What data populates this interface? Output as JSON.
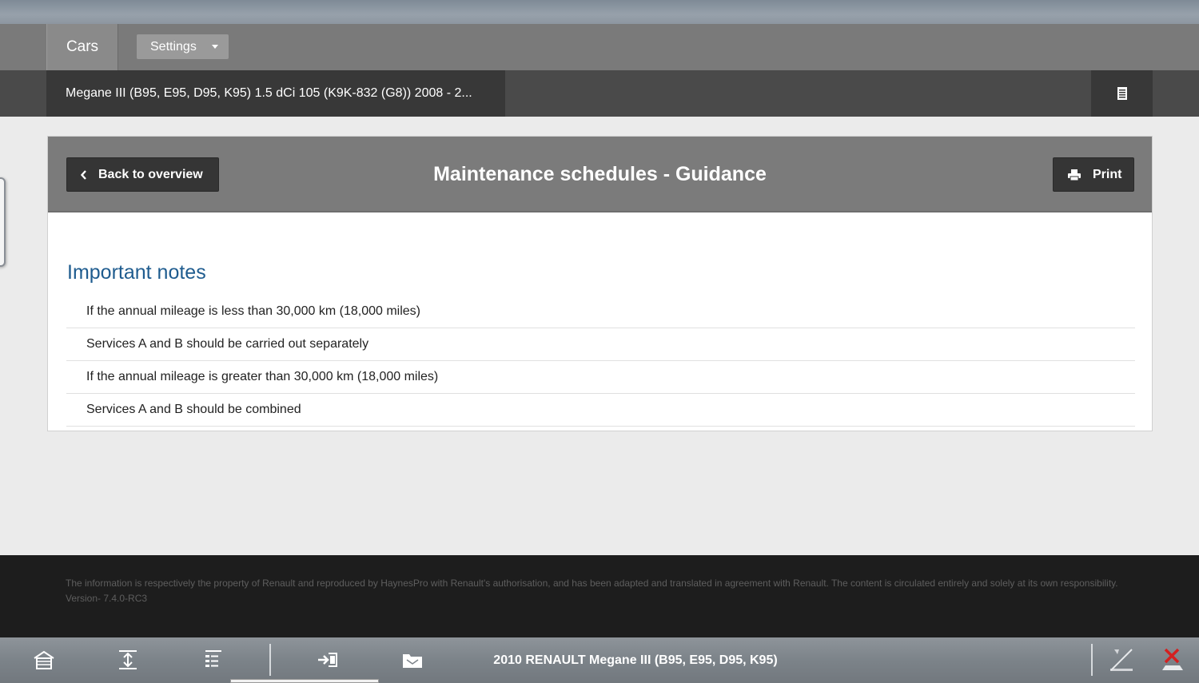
{
  "tabs": {
    "cars_label": "Cars",
    "settings_label": "Settings"
  },
  "vehicle": {
    "title": "Megane III (B95, E95, D95, K95) 1.5 dCi 105 (K9K-832 (G8)) 2008 - 2..."
  },
  "panel": {
    "back_label": "Back to overview",
    "title": "Maintenance schedules - Guidance",
    "print_label": "Print"
  },
  "notes": {
    "heading": "Important notes",
    "items": [
      "If the annual mileage is less than 30,000 km (18,000 miles)",
      "Services A and B should be carried out separately",
      "If the annual mileage is greater than 30,000 km (18,000 miles)",
      "Services A and B should be combined"
    ]
  },
  "footer": {
    "disclaimer": "The information is respectively the property of Renault and reproduced by HaynesPro with Renault's authorisation, and has been adapted and translated in agreement with Renault. The content is circulated entirely and solely at its own responsibility.",
    "version": "Version- 7.4.0-RC3"
  },
  "toolbar": {
    "vehicle_label": "2010 RENAULT Megane III (B95, E95, D95, K95)",
    "icons": [
      "home-icon",
      "expand-icon",
      "list-icon",
      "transfer-icon",
      "folder-icon",
      "stylus-icon",
      "close-icon"
    ]
  },
  "colors": {
    "accent_heading": "#1f5c8f",
    "button_dark": "#353535",
    "header_grey": "#7b7b7b",
    "close_red": "#d42020"
  }
}
